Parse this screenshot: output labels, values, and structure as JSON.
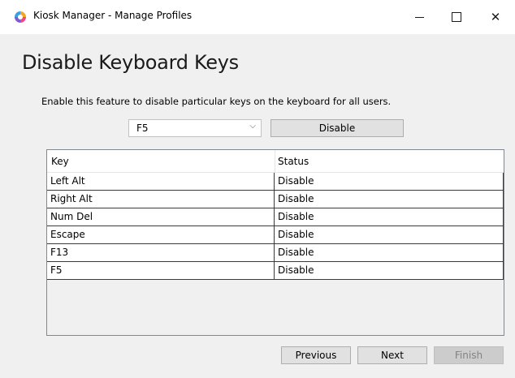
{
  "window": {
    "title": "Kiosk Manager - Manage Profiles",
    "icon": "kiosk-app-icon",
    "controls": {
      "minimize": "minimize-icon",
      "maximize": "maximize-icon",
      "close": "✕"
    }
  },
  "page": {
    "title": "Disable Keyboard Keys",
    "description": "Enable this feature to disable particular keys on the keyboard for all users."
  },
  "key_selector": {
    "selected": "F5",
    "arrow": "⌵"
  },
  "disable_button": {
    "label": "Disable"
  },
  "table": {
    "columns": [
      "Key",
      "Status"
    ],
    "rows": [
      {
        "key": "Left Alt",
        "status": "Disable"
      },
      {
        "key": "Right Alt",
        "status": "Disable"
      },
      {
        "key": "Num Del",
        "status": "Disable"
      },
      {
        "key": "Escape",
        "status": "Disable"
      },
      {
        "key": "F13",
        "status": "Disable"
      },
      {
        "key": "F5",
        "status": "Disable"
      }
    ]
  },
  "footer": {
    "previous_label": "Previous",
    "next_label": "Next",
    "finish_label": "Finish",
    "finish_enabled": false
  }
}
